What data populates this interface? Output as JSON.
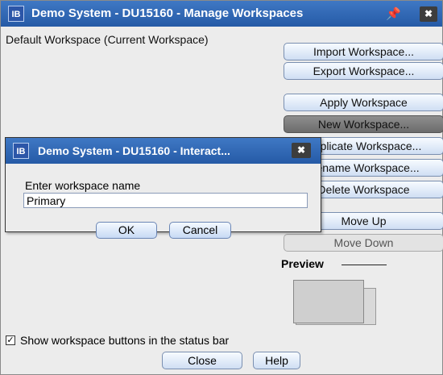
{
  "window": {
    "ib_icon": "IB",
    "title": "Demo System - DU15160 - Manage Workspaces",
    "pin_icon": "pin-icon",
    "close_label": "✖"
  },
  "current_workspace": "Default Workspace (Current Workspace)",
  "buttons": {
    "import": "Import Workspace...",
    "export": "Export Workspace...",
    "apply": "Apply Workspace",
    "new": "New Workspace...",
    "duplicate": "Duplicate Workspace...",
    "rename": "Rename Workspace...",
    "delete": "Delete Workspace",
    "move_up": "Move Up",
    "move_down": "Move Down"
  },
  "preview_label": "Preview",
  "show_buttons": {
    "checked": true,
    "label": "Show workspace buttons in the status bar"
  },
  "footer": {
    "close": "Close",
    "help": "Help"
  },
  "dialog": {
    "ib_icon": "IB",
    "title": "Demo System - DU15160 - Interact...",
    "close_label": "✖",
    "prompt": "Enter workspace name",
    "value": "Primary",
    "ok": "OK",
    "cancel": "Cancel"
  },
  "colors": {
    "titlebar": "#3366b8",
    "button_fill": "#dbe7f7",
    "selected_button": "#7c7c7c"
  }
}
